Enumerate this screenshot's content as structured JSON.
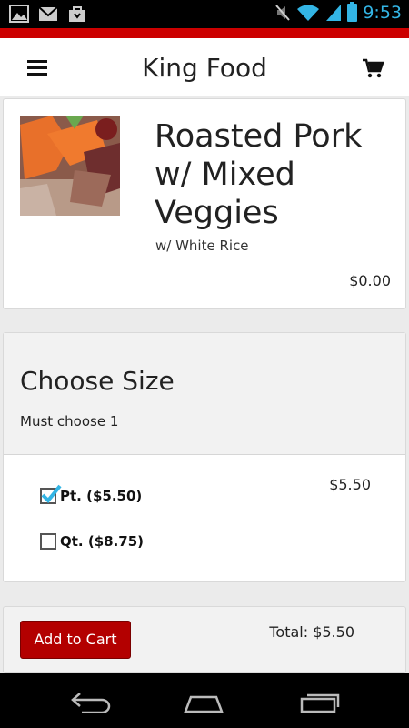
{
  "status_bar": {
    "time": "9:53",
    "icons": [
      "gallery-icon",
      "gmail-icon",
      "shopping-bag-icon",
      "mute-icon",
      "wifi-icon",
      "signal-icon",
      "battery-icon"
    ]
  },
  "header": {
    "title": "King Food",
    "menu_icon": "hamburger-menu-icon",
    "cart_icon": "cart-icon"
  },
  "item": {
    "name": "Roasted Pork w/ Mixed Veggies",
    "description": "w/ White Rice",
    "price": "$0.00"
  },
  "size_section": {
    "title": "Choose Size",
    "subtitle": "Must choose 1",
    "selected_price": "$5.50",
    "options": [
      {
        "label": "Pt. ($5.50)",
        "checked": true
      },
      {
        "label": "Qt. ($8.75)",
        "checked": false
      }
    ]
  },
  "footer": {
    "add_button": "Add to Cart",
    "total": "Total: $5.50"
  },
  "nav_bar": {
    "icons": [
      "back-icon",
      "home-icon",
      "recent-apps-icon"
    ]
  },
  "colors": {
    "brand_red": "#cc0000",
    "button_red": "#b30000",
    "accent_blue": "#33b5e5"
  }
}
